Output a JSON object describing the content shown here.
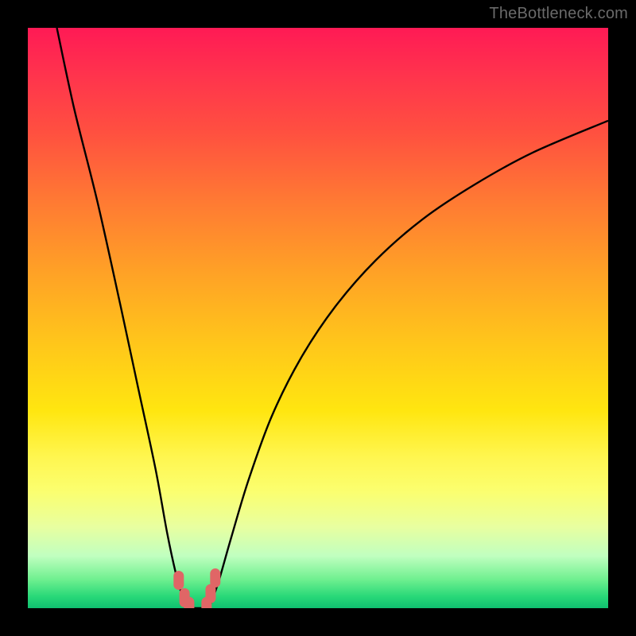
{
  "watermark": "TheBottleneck.com",
  "chart_data": {
    "type": "line",
    "title": "",
    "xlabel": "",
    "ylabel": "",
    "xlim": [
      0,
      100
    ],
    "ylim": [
      0,
      100
    ],
    "curve_left": {
      "x": [
        5,
        8,
        12,
        16,
        19,
        22,
        24,
        25.5,
        26.5,
        27.3,
        27.8
      ],
      "y": [
        100,
        86,
        70,
        52,
        38,
        24,
        13,
        6,
        2.5,
        0.8,
        0
      ]
    },
    "curve_right": {
      "x": [
        31.2,
        31.8,
        33,
        35,
        38,
        42,
        47,
        53,
        60,
        68,
        77,
        87,
        100
      ],
      "y": [
        0,
        1.5,
        5,
        12,
        22,
        33,
        43,
        52,
        60,
        67,
        73,
        78.5,
        84
      ]
    },
    "valley_floor": {
      "x": [
        27.8,
        28.5,
        29.5,
        30.4,
        31.2
      ],
      "y": [
        0,
        0,
        0,
        0,
        0
      ]
    },
    "markers": [
      {
        "x": 26.0,
        "y": 4.8
      },
      {
        "x": 27.0,
        "y": 1.8
      },
      {
        "x": 27.8,
        "y": 0.3
      },
      {
        "x": 30.8,
        "y": 0.3
      },
      {
        "x": 31.5,
        "y": 2.5
      },
      {
        "x": 32.3,
        "y": 5.2
      }
    ],
    "marker_color": "#e06666",
    "curve_color": "#000000"
  }
}
